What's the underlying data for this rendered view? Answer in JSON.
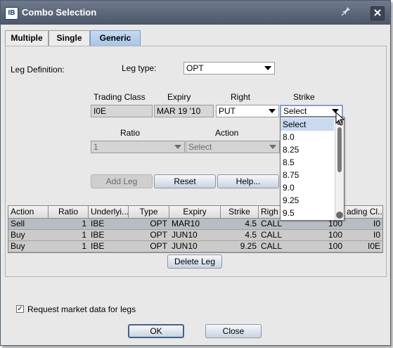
{
  "window": {
    "title": "Combo Selection",
    "logo_text": "IB",
    "pin_icon": "pin-icon",
    "close_icon": "close-icon"
  },
  "tabs": [
    {
      "label": "Multiple"
    },
    {
      "label": "Single"
    },
    {
      "label": "Generic"
    }
  ],
  "leg": {
    "definition_label": "Leg Definition:",
    "type_label": "Leg type:",
    "type_value": "OPT",
    "headers": {
      "trading_class": "Trading Class",
      "expiry": "Expiry",
      "right": "Right",
      "strike": "Strike",
      "ratio": "Ratio",
      "action": "Action"
    },
    "trading_class": "I0E",
    "expiry": "MAR 19 '10",
    "right": "PUT",
    "strike": "Select",
    "ratio": "1",
    "action": "Select"
  },
  "strike_options": [
    "Select",
    "8.0",
    "8.25",
    "8.5",
    "8.75",
    "9.0",
    "9.25",
    "9.5"
  ],
  "buttons": {
    "add_leg": "Add Leg",
    "reset": "Reset",
    "help": "Help...",
    "delete_leg": "Delete Leg",
    "ok": "OK",
    "close": "Close"
  },
  "table": {
    "columns": [
      "Action",
      "Ratio",
      "Underlyi...",
      "Type",
      "Expiry",
      "Strike",
      "Righ",
      "",
      "ading Cl..."
    ],
    "rows": [
      [
        "Sell",
        "1",
        "IBE",
        "OPT",
        "MAR10",
        "4.5",
        "CALL",
        "100",
        "I0"
      ],
      [
        "Buy",
        "1",
        "IBE",
        "OPT",
        "JUN10",
        "4.5",
        "CALL",
        "100",
        "I0"
      ],
      [
        "Buy",
        "1",
        "IBE",
        "OPT",
        "JUN10",
        "9.25",
        "CALL",
        "100",
        "I0E"
      ]
    ]
  },
  "request_market_data": {
    "label": "Request market data for legs",
    "checked": true,
    "mark": "✓"
  }
}
